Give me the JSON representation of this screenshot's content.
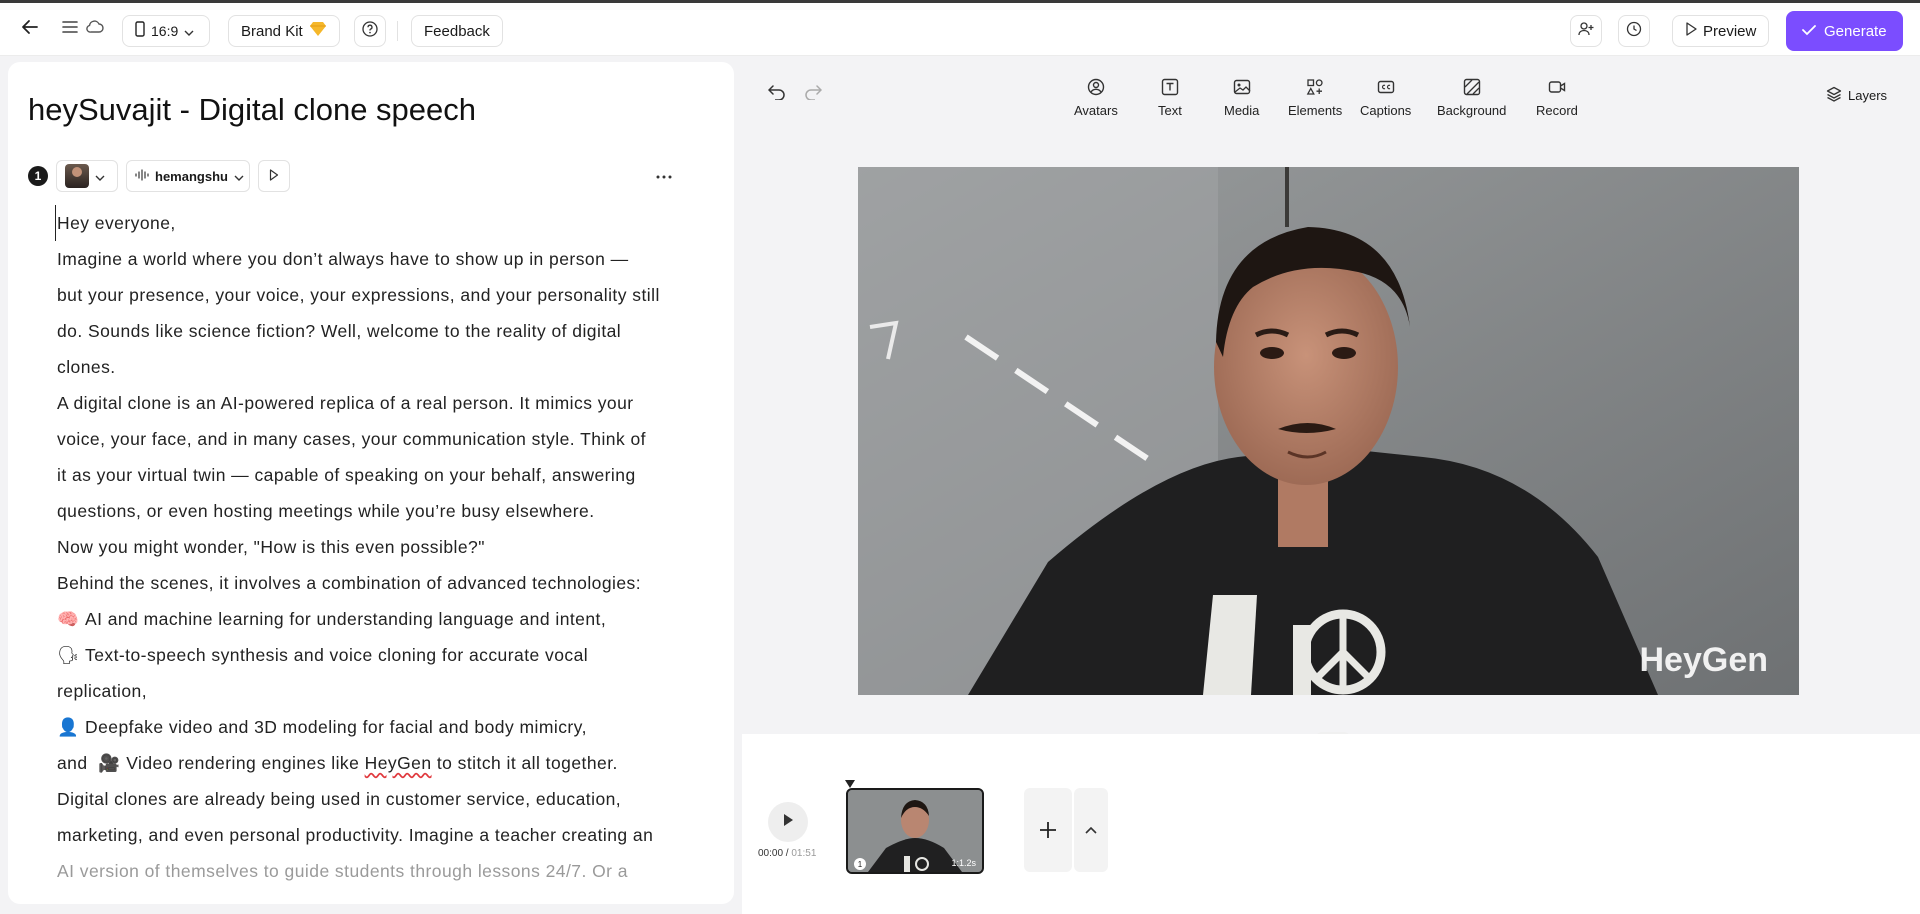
{
  "header": {
    "aspect_ratio": "16:9",
    "brand_kit": "Brand Kit",
    "feedback": "Feedback",
    "preview": "Preview",
    "generate": "Generate"
  },
  "project": {
    "title": "heySuvajit - Digital clone speech"
  },
  "scene": {
    "number": "1",
    "voice": "hemangshu"
  },
  "script": {
    "lines": [
      "Hey everyone,",
      "Imagine a world where you don’t always have to show up in person —",
      "but your presence, your voice, your expressions, and your personality still",
      "do. Sounds like science fiction? Well, welcome to the reality of digital",
      "clones.",
      "A digital clone is an AI-powered replica of a real person. It mimics your",
      "voice, your face, and in many cases, your communication style. Think of",
      "it as your virtual twin — capable of speaking on your behalf, answering",
      "questions, or even hosting meetings while you’re busy elsewhere.",
      "Now you might wonder, \"How is this even possible?\"",
      "Behind the scenes, it involves a combination of advanced technologies:",
      "AI and machine learning for understanding language and intent,",
      "Text-to-speech synthesis and voice cloning for accurate vocal",
      "replication,",
      "Deepfake video and 3D modeling for facial and body mimicry,",
      "Video rendering engines like",
      "HeyGen",
      "to stitch it all together.",
      "Digital clones are already being used in customer service, education,",
      "marketing, and even personal productivity. Imagine a teacher creating an",
      "AI version of themselves to guide students through lessons 24/7. Or a"
    ],
    "and_word": "and"
  },
  "toolbar": {
    "avatars": "Avatars",
    "text": "Text",
    "media": "Media",
    "elements": "Elements",
    "captions": "Captions",
    "background": "Background",
    "record": "Record",
    "layers": "Layers"
  },
  "canvas": {
    "watermark": "HeyGen"
  },
  "timeline": {
    "current_time": "00:00",
    "separator": " / ",
    "total_time": "01:51",
    "clip_number": "1",
    "clip_duration": "1:1.2s"
  },
  "colors": {
    "accent": "#7b4dff",
    "brand_kit_icon": "#f5b72a"
  }
}
